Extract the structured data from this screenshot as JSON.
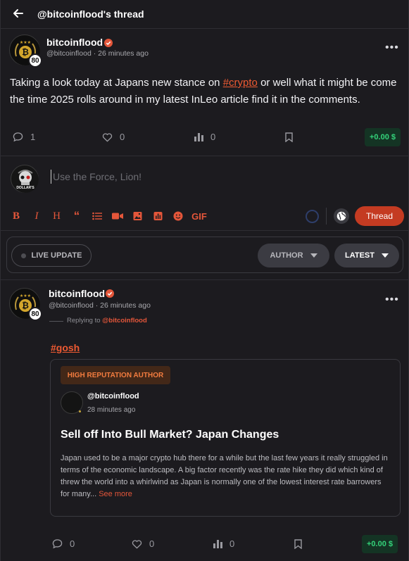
{
  "header": {
    "title": "@bitcoinflood's thread"
  },
  "post": {
    "author": "bitcoinflood",
    "handle": "@bitcoinflood",
    "time": "26 minutes ago",
    "reputation": "80",
    "text_before": "Taking a look today at Japans new stance on ",
    "tag": "#crypto",
    "text_after": " or well what it might be come the time 2025 rolls around in my latest InLeo article find it in the comments.",
    "comments": "1",
    "likes": "0",
    "votes": "0",
    "earnings": "+0.00 $"
  },
  "composer": {
    "placeholder": "Use the Force, Lion!",
    "gif_label": "GIF",
    "submit_label": "Thread",
    "avatar_text": "DOLLAR'S"
  },
  "filters": {
    "live": "LIVE UPDATE",
    "author": "AUTHOR",
    "latest": "LATEST"
  },
  "reply": {
    "author": "bitcoinflood",
    "handle": "@bitcoinflood",
    "time": "26 minutes ago",
    "reputation": "80",
    "replying_prefix": "Replying to ",
    "replying_to": "@bitcoinflood",
    "hashtag": "#gosh",
    "card": {
      "badge": "HIGH REPUTATION AUTHOR",
      "handle": "@bitcoinflood",
      "time": "28 minutes ago",
      "title": "Sell off Into Bull Market? Japan Changes",
      "body": "Japan used to be a major crypto hub there for a while but the last few years it really struggled in terms of the economic landscape. A big factor recently was the rate hike they did which kind of threw the world into a whirlwind as Japan is normally one of the lowest interest rate barrowers for many... ",
      "see_more": "See more"
    },
    "comments": "0",
    "likes": "0",
    "votes": "0",
    "earnings": "+0.00 $"
  },
  "colors": {
    "background": "#1c1b1f",
    "accent": "#e4563a",
    "earn_bg": "#143424",
    "earn_text": "#34d27a"
  }
}
